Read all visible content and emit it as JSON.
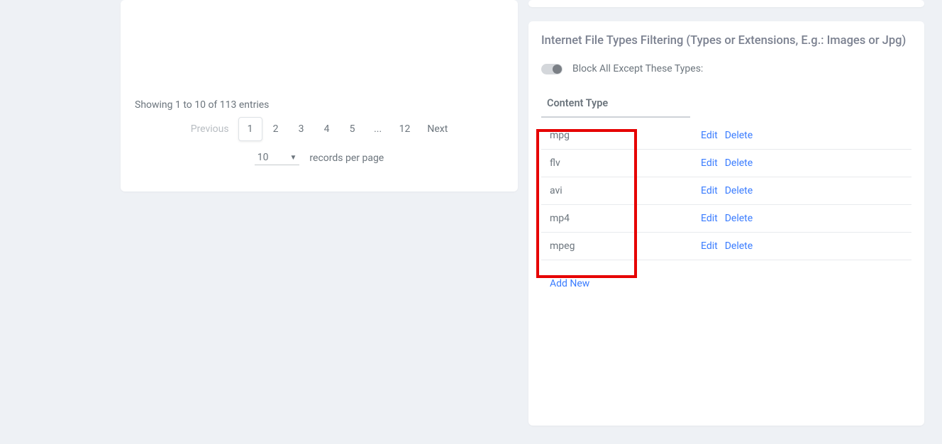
{
  "left": {
    "entries_text": "Showing 1 to 10 of 113 entries",
    "pagination": {
      "previous": "Previous",
      "pages": [
        "1",
        "2",
        "3",
        "4",
        "5",
        "...",
        "12"
      ],
      "next": "Next",
      "active": "1"
    },
    "records": {
      "value": "10",
      "label": "records per page"
    }
  },
  "right": {
    "title": "Internet File Types Filtering (Types or Extensions, E.g.: Images or Jpg)",
    "toggle_label": "Block All Except These Types:",
    "table": {
      "header": "Content Type",
      "rows": [
        {
          "type": "mpg",
          "edit": "Edit",
          "delete": "Delete"
        },
        {
          "type": "flv",
          "edit": "Edit",
          "delete": "Delete"
        },
        {
          "type": "avi",
          "edit": "Edit",
          "delete": "Delete"
        },
        {
          "type": "mp4",
          "edit": "Edit",
          "delete": "Delete"
        },
        {
          "type": "mpeg",
          "edit": "Edit",
          "delete": "Delete"
        }
      ],
      "add_new": "Add New"
    }
  }
}
